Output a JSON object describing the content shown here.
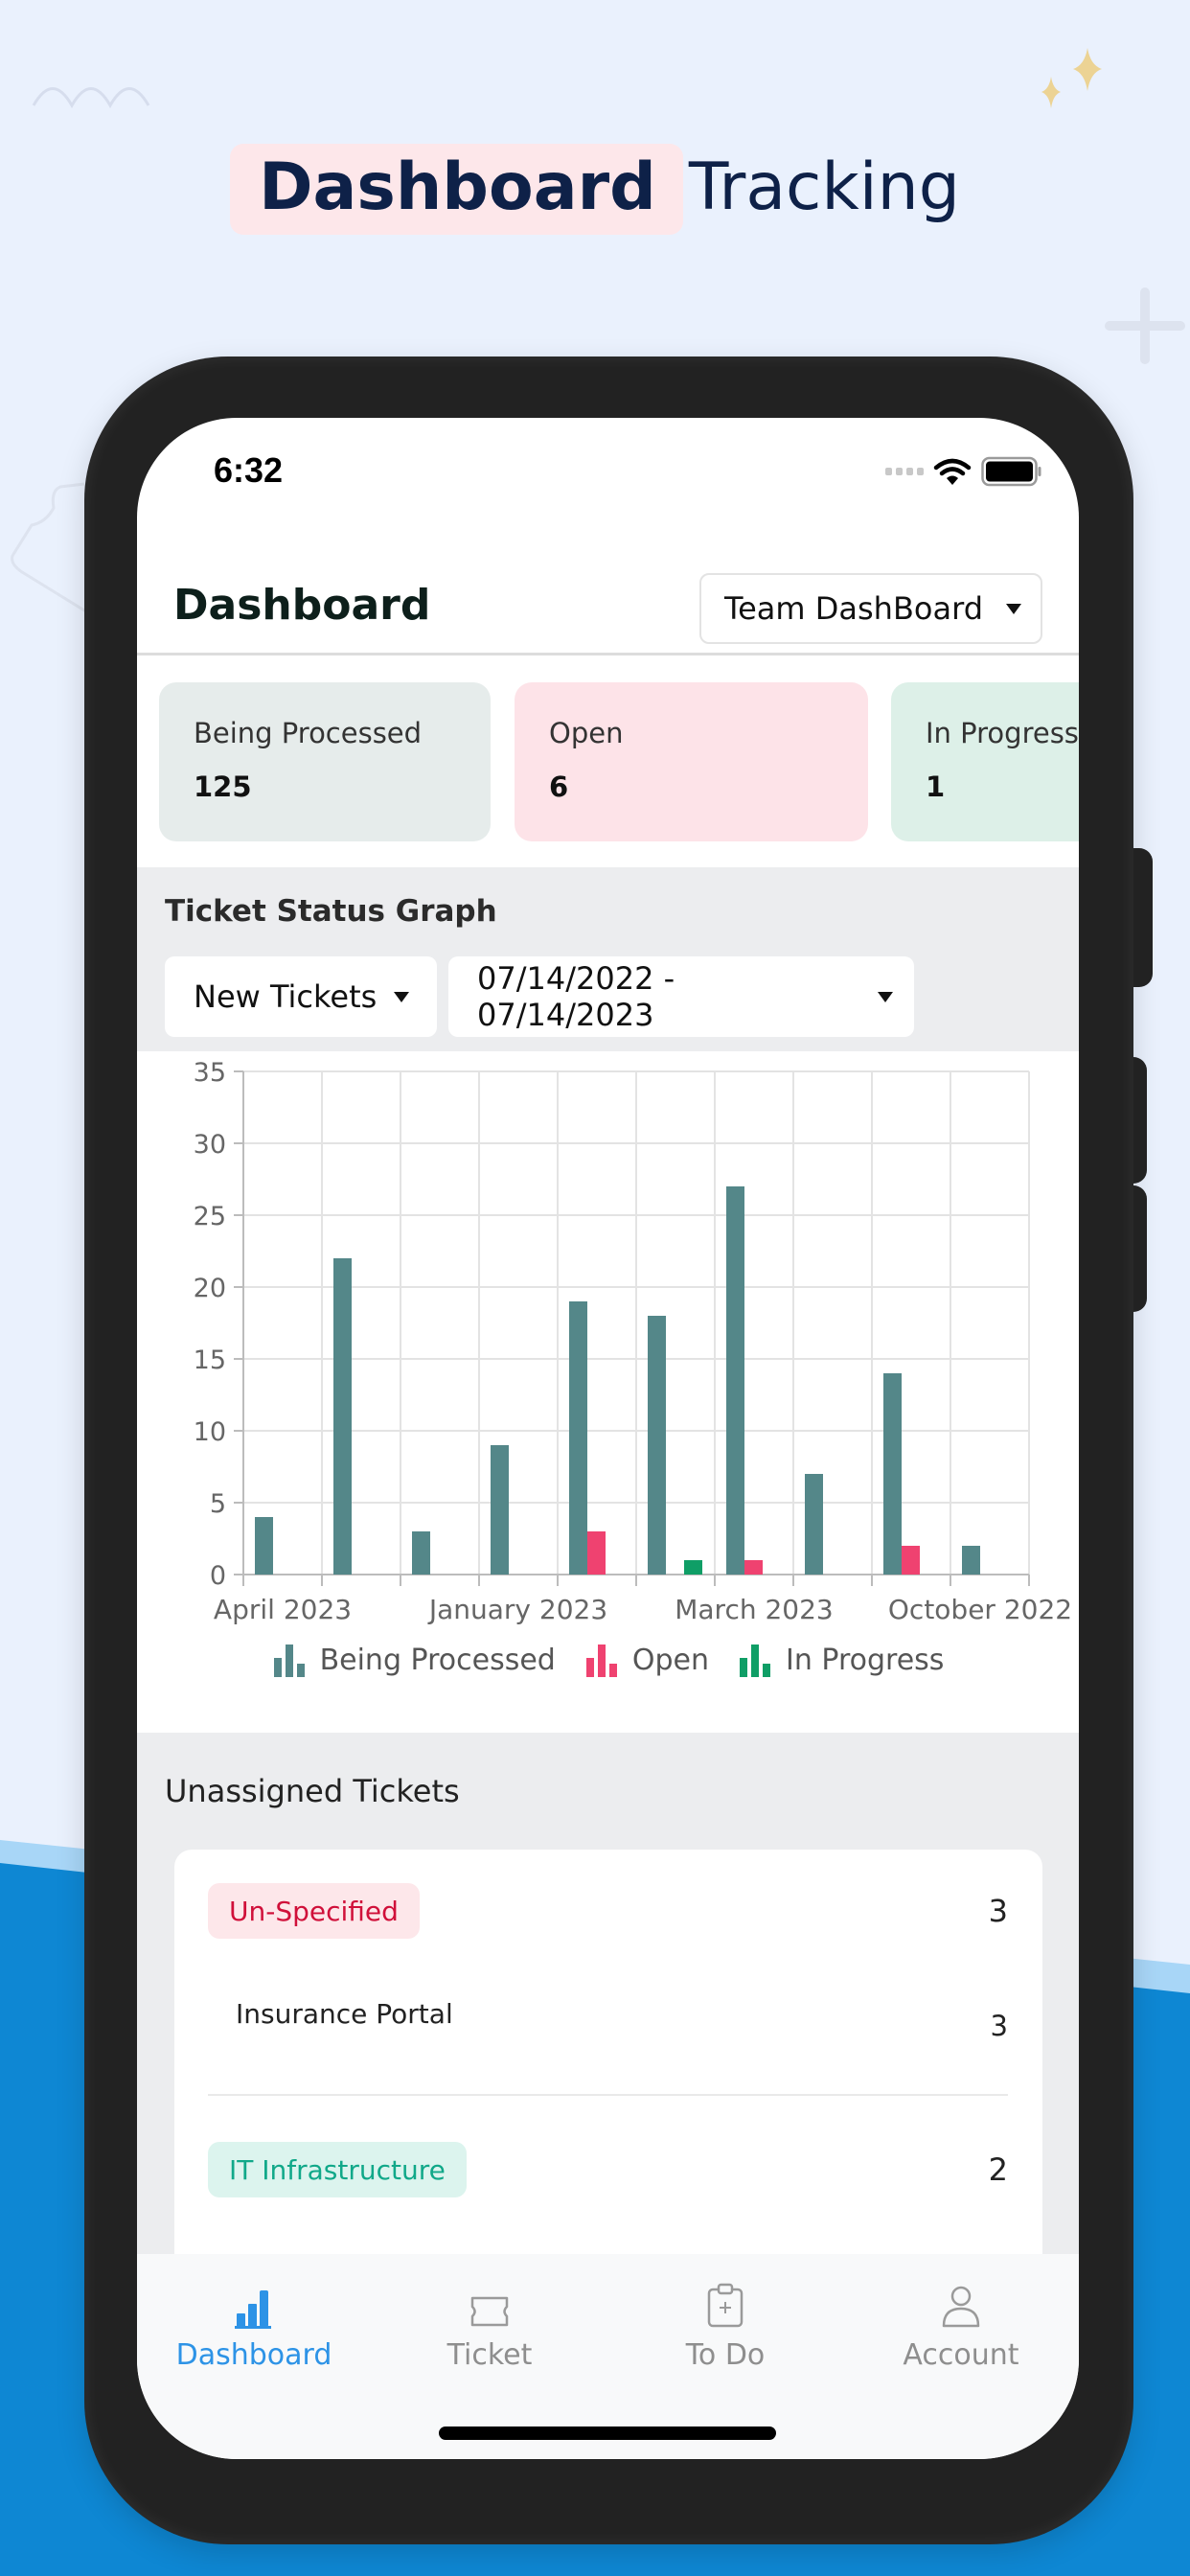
{
  "headline": {
    "bold": "Dashboard",
    "light": "Tracking"
  },
  "status_bar": {
    "time": "6:32"
  },
  "header": {
    "title": "Dashboard",
    "team_select": "Team DashBoard"
  },
  "stat_cards": [
    {
      "label": "Being Processed",
      "value": "125",
      "bg": "#e6eceb"
    },
    {
      "label": "Open",
      "value": "6",
      "bg": "#fde3e8"
    },
    {
      "label": "In Progress",
      "value": "1",
      "bg": "#ddf0e8"
    }
  ],
  "graph": {
    "title": "Ticket Status Graph",
    "type_select": "New Tickets",
    "range_select": "07/14/2022 - 07/14/2023"
  },
  "chart_data": {
    "type": "bar",
    "title": "Ticket Status Graph",
    "xlabel": "",
    "ylabel": "",
    "ylim": [
      0,
      35
    ],
    "yticks": [
      0,
      5,
      10,
      15,
      20,
      25,
      30,
      35
    ],
    "grid": true,
    "legend_position": "bottom",
    "categories_count": 10,
    "x_tick_labels": [
      {
        "index": 0,
        "label": "April 2023"
      },
      {
        "index": 3,
        "label": "January 2023"
      },
      {
        "index": 6,
        "label": "March 2023"
      },
      {
        "index": 9,
        "label": "October 2022"
      }
    ],
    "series": [
      {
        "name": "Being Processed",
        "color": "#548789",
        "values": [
          4,
          22,
          3,
          9,
          19,
          18,
          27,
          7,
          14,
          2
        ]
      },
      {
        "name": "Open",
        "color": "#ef4270",
        "values": [
          0,
          0,
          0,
          0,
          3,
          0,
          1,
          0,
          2,
          0
        ]
      },
      {
        "name": "In Progress",
        "color": "#0f9e66",
        "values": [
          0,
          0,
          0,
          0,
          0,
          1,
          0,
          0,
          0,
          0
        ]
      }
    ]
  },
  "unassigned": {
    "title": "Unassigned Tickets",
    "groups": [
      {
        "tag": "Un-Specified",
        "tag_color": "#d0103a",
        "tag_bg": "#fde7ea",
        "count": "3",
        "items": [
          {
            "label": "Insurance Portal",
            "count": "3"
          }
        ]
      },
      {
        "tag": "IT Infrastructure",
        "tag_color": "#11a889",
        "tag_bg": "#dcf4ee",
        "count": "2",
        "items": []
      }
    ]
  },
  "tabbar": {
    "active_color": "#2d93e6",
    "tabs": [
      {
        "label": "Dashboard",
        "icon": "bar-chart-icon",
        "active": true
      },
      {
        "label": "Ticket",
        "icon": "ticket-icon",
        "active": false
      },
      {
        "label": "To Do",
        "icon": "clipboard-plus-icon",
        "active": false
      },
      {
        "label": "Account",
        "icon": "person-icon",
        "active": false
      }
    ]
  }
}
